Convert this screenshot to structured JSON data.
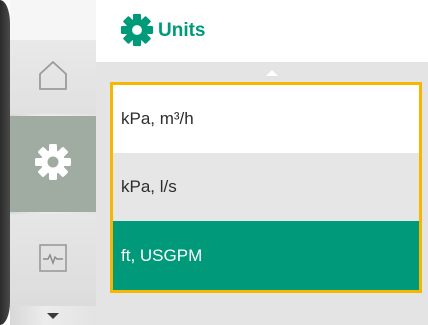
{
  "header": {
    "title": "Units",
    "icon": "gear-icon"
  },
  "sidebar": {
    "items": [
      {
        "name": "home",
        "icon": "home-icon"
      },
      {
        "name": "settings",
        "icon": "gear-icon",
        "active": true
      },
      {
        "name": "diagnostics",
        "icon": "diagnostics-icon"
      }
    ],
    "scroll_icon": "chevron-down-icon"
  },
  "list": {
    "scroll_icon": "chevron-up-icon",
    "options": [
      {
        "label": "kPa, m³/h",
        "selected": false
      },
      {
        "label": "kPa, l/s",
        "selected": false
      },
      {
        "label": "ft, USGPM",
        "selected": true
      }
    ]
  },
  "colors": {
    "accent": "#009a7b",
    "focus_frame": "#f6b700",
    "sidebar_active": "#a0aca1"
  }
}
